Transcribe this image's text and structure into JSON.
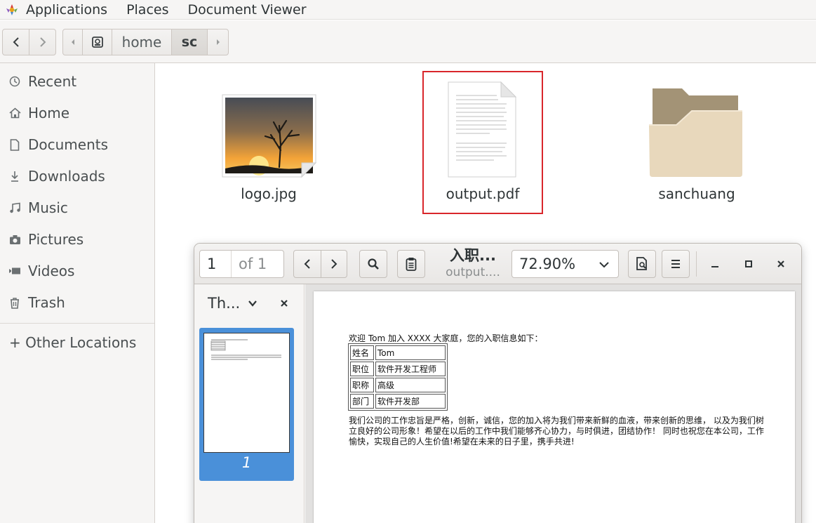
{
  "top_panel": {
    "applications": "Applications",
    "places": "Places",
    "active_app": "Document Viewer"
  },
  "files_toolbar": {
    "path": [
      "home",
      "sc"
    ]
  },
  "sidebar": {
    "items": [
      {
        "label": "Recent",
        "icon": "clock-icon"
      },
      {
        "label": "Home",
        "icon": "home-icon"
      },
      {
        "label": "Documents",
        "icon": "document-icon"
      },
      {
        "label": "Downloads",
        "icon": "download-icon"
      },
      {
        "label": "Music",
        "icon": "music-icon"
      },
      {
        "label": "Pictures",
        "icon": "camera-icon"
      },
      {
        "label": "Videos",
        "icon": "video-icon"
      },
      {
        "label": "Trash",
        "icon": "trash-icon"
      }
    ],
    "other_locations": "+ Other Locations"
  },
  "files": [
    {
      "name": "logo.jpg",
      "type": "image"
    },
    {
      "name": "output.pdf",
      "type": "pdf",
      "selected": true
    },
    {
      "name": "sanchuang",
      "type": "folder"
    }
  ],
  "viewer": {
    "page_current": "1",
    "page_total": "of 1",
    "title": "入职...",
    "subtitle": "output....",
    "zoom": "72.90%",
    "sidebar_mode": "Th...",
    "thumb_page_number": "1",
    "document": {
      "intro": "欢迎 Tom 加入 XXXX 大家庭，您的入职信息如下：",
      "table": [
        {
          "key": "姓名",
          "value": "Tom"
        },
        {
          "key": "职位",
          "value": "软件开发工程师"
        },
        {
          "key": "职称",
          "value": "高级"
        },
        {
          "key": "部门",
          "value": "软件开发部"
        }
      ],
      "paragraph": "我们公司的工作忠旨是严格，创新，诚信，您的加入将为我们带来新鲜的血液，带来创新的思维， 以及为我们树立良好的公司形象！希望在以后的工作中我们能够齐心协力，与时俱进，团结协作！ 同时也祝您在本公司，工作愉快，实现自己的人生价值!希望在未来的日子里，携手共进!"
    }
  },
  "colors": {
    "selection_border": "#d9262b",
    "thumb_selected": "#4a90d9",
    "panel_bg": "#f6f5f4"
  }
}
